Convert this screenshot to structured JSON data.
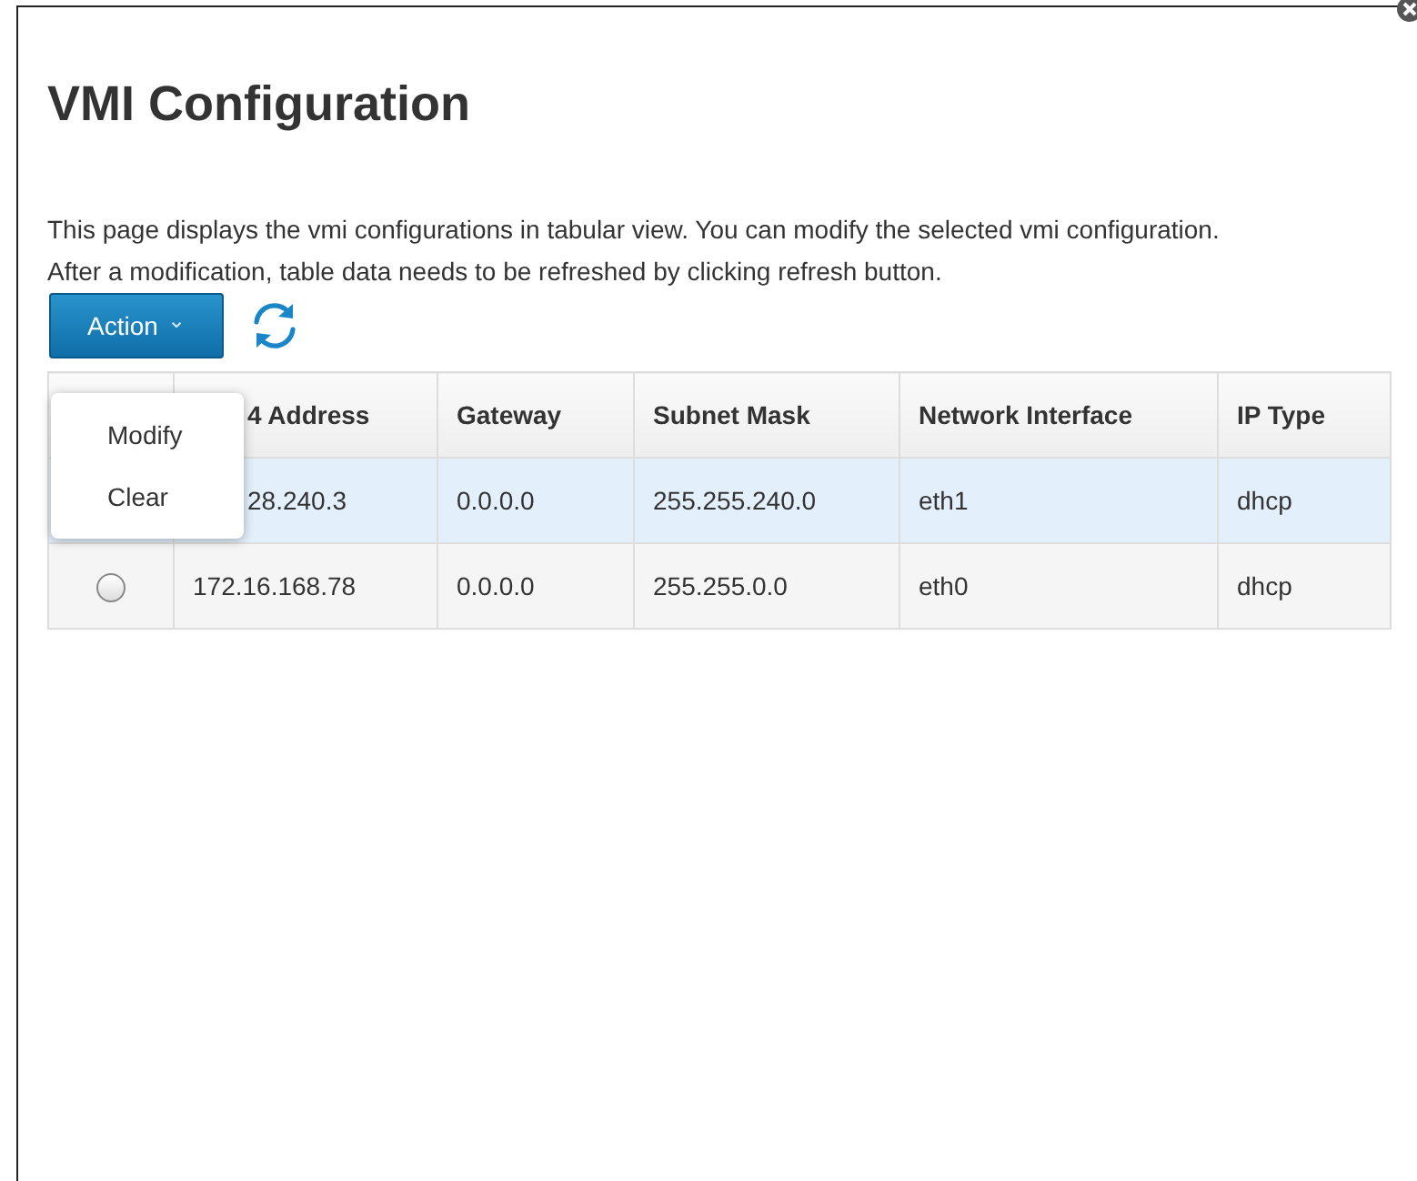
{
  "title": "VMI Configuration",
  "description": [
    "This page displays the vmi configurations in tabular view. You can modify the selected vmi configuration.",
    "After a modification, table data needs to be refreshed by clicking refresh button."
  ],
  "action_button": {
    "label": "Action",
    "caret": "⌄"
  },
  "action_menu": {
    "open": true,
    "items": [
      {
        "label": "Modify"
      },
      {
        "label": "Clear"
      }
    ]
  },
  "table": {
    "columns": [
      "4 Address",
      "Gateway",
      "Subnet Mask",
      "Network Interface",
      "IP Type"
    ],
    "rows": [
      {
        "selected": true,
        "cells": [
          "28.240.3",
          "0.0.0.0",
          "255.255.240.0",
          "eth1",
          "dhcp"
        ]
      },
      {
        "selected": false,
        "cells": [
          "172.16.168.78",
          "0.0.0.0",
          "255.255.0.0",
          "eth0",
          "dhcp"
        ]
      }
    ]
  }
}
